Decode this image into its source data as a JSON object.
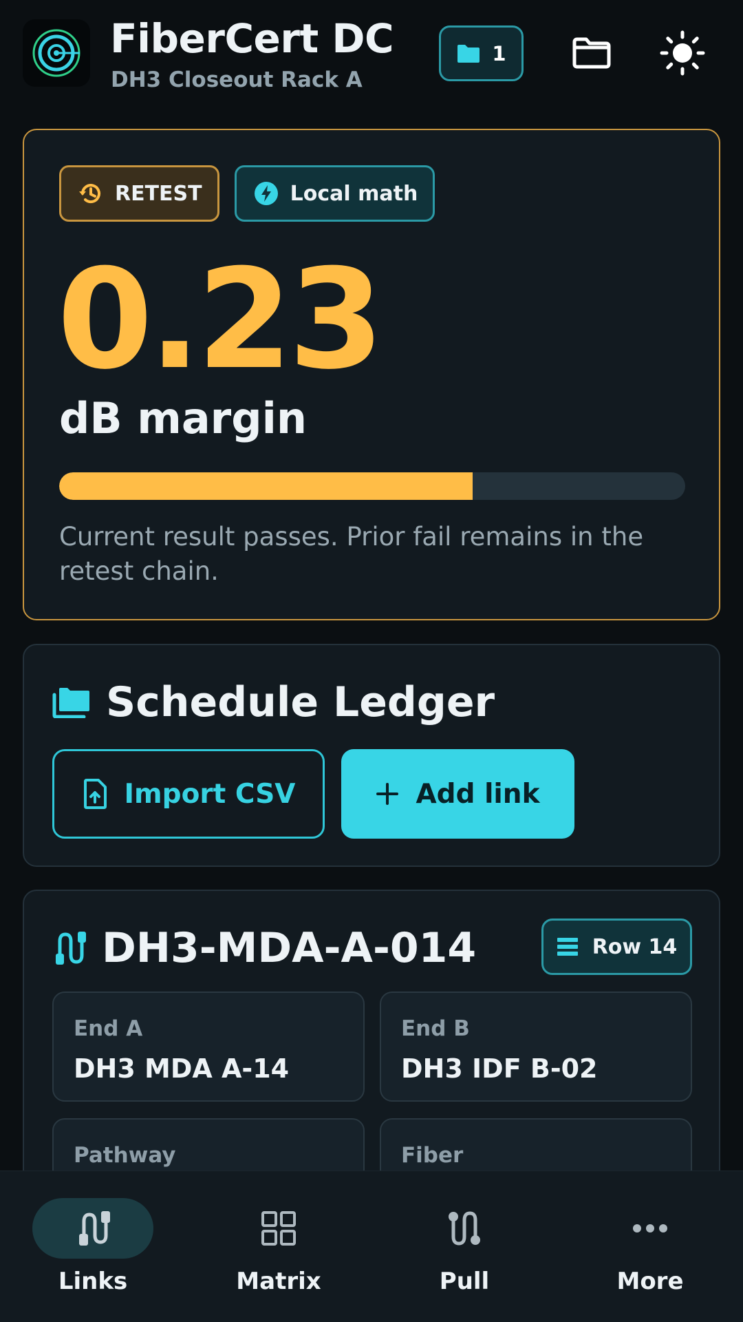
{
  "header": {
    "title": "FiberCert DC",
    "subtitle": "DH3 Closeout Rack A",
    "folder_count": "1"
  },
  "margin_card": {
    "badges": [
      {
        "label": "RETEST",
        "icon": "history-icon"
      },
      {
        "label": "Local math",
        "icon": "bolt-icon"
      }
    ],
    "value": "0.23",
    "unit": "dB margin",
    "progress": 0.66,
    "note": "Current result passes. Prior fail remains in the retest chain.",
    "accent": "#ffbd47"
  },
  "ledger": {
    "title": "Schedule Ledger",
    "import_label": "Import CSV",
    "add_label": "Add link"
  },
  "link": {
    "id": "DH3-MDA-A-014",
    "row_label": "Row 14",
    "fields": [
      {
        "label": "End A",
        "value": "DH3 MDA A-14"
      },
      {
        "label": "End B",
        "value": "DH3 IDF B-02"
      },
      {
        "label": "Pathway",
        "value": ""
      },
      {
        "label": "Fiber",
        "value": ""
      }
    ]
  },
  "nav": {
    "items": [
      {
        "label": "Links",
        "icon": "links-icon",
        "active": true
      },
      {
        "label": "Matrix",
        "icon": "grid-icon",
        "active": false
      },
      {
        "label": "Pull",
        "icon": "pull-icon",
        "active": false
      },
      {
        "label": "More",
        "icon": "more-icon",
        "active": false
      }
    ]
  },
  "colors": {
    "accent_cyan": "#38d5e6",
    "accent_amber": "#ffbd47",
    "background": "#0b0f12",
    "card": "#121a20"
  }
}
